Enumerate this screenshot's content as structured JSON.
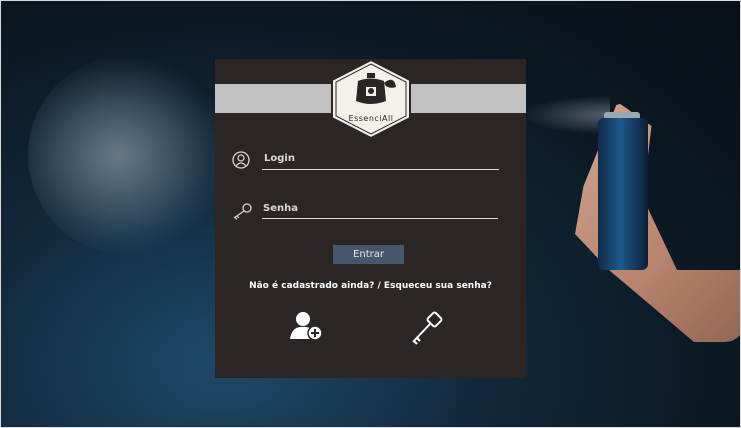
{
  "logo": {
    "text": "EssenciAll",
    "icon": "perfume-bottle-icon"
  },
  "form": {
    "login_label": "Login",
    "password_label": "Senha",
    "login_icon": "user-circle-icon",
    "password_icon": "key-icon",
    "submit_label": "Entrar"
  },
  "links": {
    "text": "Não é cadastrado ainda? / Esqueceu sua senha?",
    "register_icon": "add-user-icon",
    "forgot_icon": "key-icon"
  },
  "colors": {
    "panel": "#2b2625",
    "header_bar": "#c1c1c1",
    "button": "#45566e",
    "text": "#d9d9d9"
  }
}
